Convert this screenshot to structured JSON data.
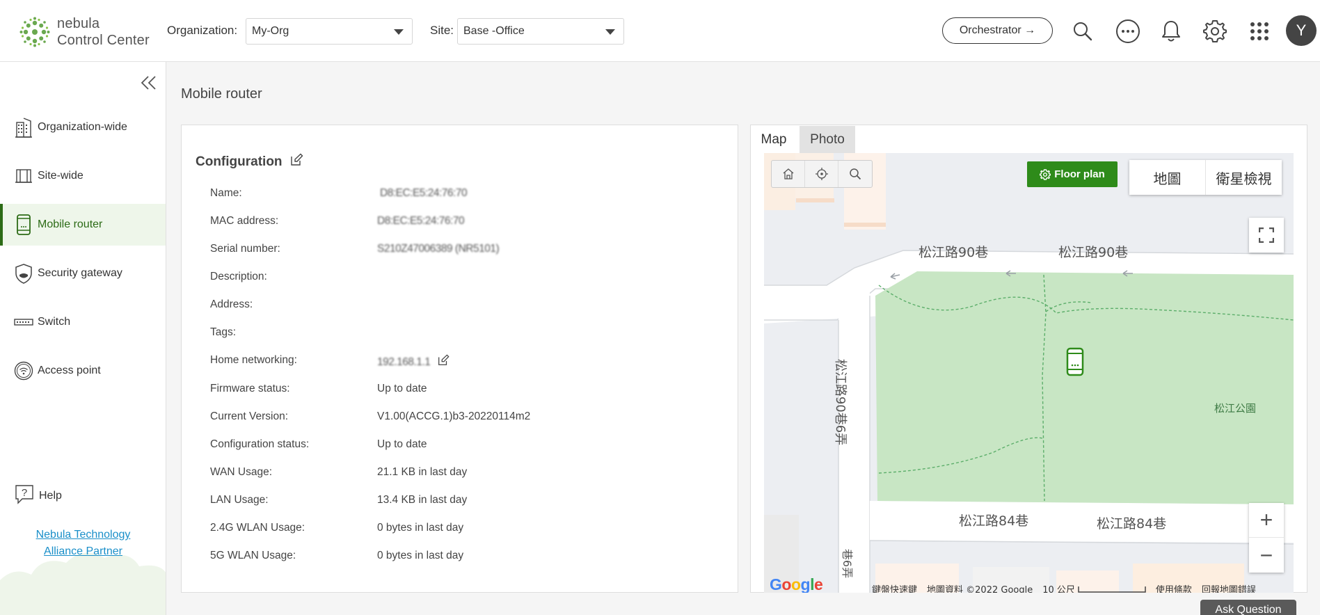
{
  "header": {
    "logo_line1": "nebula",
    "logo_line2": "Control Center",
    "org_label": "Organization:",
    "org_value": "My-Org",
    "site_label": "Site:",
    "site_value": "Base -Office",
    "orchestrator_label": "Orchestrator →",
    "avatar_letter": "Y"
  },
  "sidebar": {
    "items": [
      {
        "label": "Organization-wide",
        "icon": "building-icon"
      },
      {
        "label": "Site-wide",
        "icon": "site-icon"
      },
      {
        "label": "Mobile router",
        "icon": "mobile-router-icon"
      },
      {
        "label": "Security gateway",
        "icon": "shield-icon"
      },
      {
        "label": "Switch",
        "icon": "switch-icon"
      },
      {
        "label": "Access point",
        "icon": "access-point-icon"
      }
    ],
    "active_index": 2,
    "help_label": "Help",
    "partner_line1": "Nebula Technology",
    "partner_line2": "Alliance Partner"
  },
  "main": {
    "page_title": "Mobile router",
    "config": {
      "title": "Configuration",
      "rows": [
        {
          "label": "Name:",
          "value": "D8:EC:E5:24:76:70"
        },
        {
          "label": "MAC address:",
          "value": "D8:EC:E5:24:76:70"
        },
        {
          "label": "Serial number:",
          "value": "S210Z47006389 (NR5101)"
        },
        {
          "label": "Description:",
          "value": ""
        },
        {
          "label": "Address:",
          "value": ""
        },
        {
          "label": "Tags:",
          "value": ""
        },
        {
          "label": "Home networking:",
          "value": "192.168.1.1"
        },
        {
          "label": "Firmware status:",
          "value": "Up to date"
        },
        {
          "label": "Current Version:",
          "value": "V1.00(ACCG.1)b3-20220114m2"
        },
        {
          "label": "Configuration status:",
          "value": "Up to date"
        },
        {
          "label": "WAN Usage:",
          "value": "21.1 KB in last day"
        },
        {
          "label": "LAN Usage:",
          "value": "13.4 KB in last day"
        },
        {
          "label": "2.4G WLAN Usage:",
          "value": "0 bytes in last day"
        },
        {
          "label": "5G WLAN Usage:",
          "value": "0 bytes in last day"
        }
      ]
    },
    "map": {
      "tabs": [
        "Map",
        "Photo"
      ],
      "floor_plan_label": "Floor plan",
      "map_type_map": "地圖",
      "map_type_satellite": "衛星檢視",
      "zoom_in": "+",
      "zoom_out": "−",
      "streets": {
        "top_left": "松江路90巷",
        "top_right": "松江路90巷",
        "bottom_left": "松江路84巷",
        "bottom_right": "松江路84巷",
        "vertical": "松江路90巷6弄",
        "vertical_bottom": "巷6弄"
      },
      "park": "松江公園",
      "google": "Google",
      "attribution": [
        "鍵盤快速鍵",
        "地圖資料 ©2022 Google",
        "10 公尺",
        "使用條款",
        "回報地圖錯誤"
      ]
    },
    "ask_question": "Ask Question"
  },
  "colors": {
    "brand_green": "#2e8b1a",
    "active_green": "#2c6b16",
    "park_green": "#c8e6c4",
    "link_blue": "#1a8fc9"
  }
}
